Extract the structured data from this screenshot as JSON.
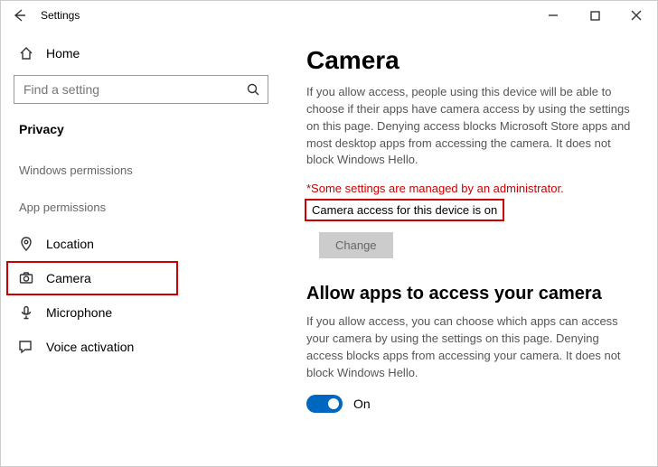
{
  "titlebar": {
    "title": "Settings"
  },
  "sidebar": {
    "home_label": "Home",
    "search_placeholder": "Find a setting",
    "section": "Privacy",
    "group_windows": "Windows permissions",
    "group_app": "App permissions",
    "items": {
      "location": "Location",
      "camera": "Camera",
      "microphone": "Microphone",
      "voice": "Voice activation"
    }
  },
  "main": {
    "heading": "Camera",
    "intro": "If you allow access, people using this device will be able to choose if their apps have camera access by using the settings on this page. Denying access blocks Microsoft Store apps and most desktop apps from accessing the camera. It does not block Windows Hello.",
    "admin_notice": "*Some settings are managed by an administrator.",
    "device_access_status": "Camera access for this device is on",
    "change_btn": "Change",
    "allow_heading": "Allow apps to access your camera",
    "allow_para": "If you allow access, you can choose which apps can access your camera by using the settings on this page. Denying access blocks apps from accessing your camera. It does not block Windows Hello.",
    "toggle_label": "On"
  }
}
